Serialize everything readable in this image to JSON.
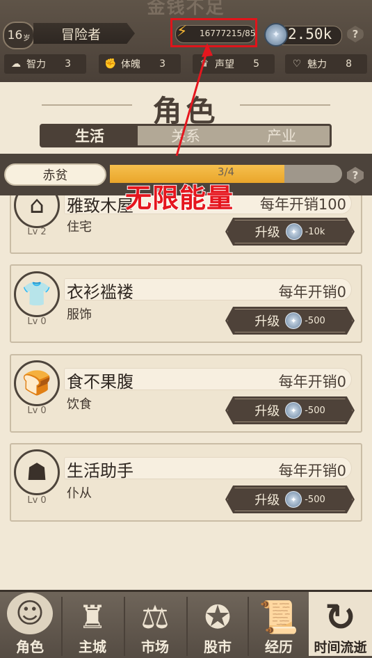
{
  "header": {
    "faded_title": "金钱不足",
    "age": "16",
    "age_unit": "岁",
    "title": "冒险者",
    "energy": "16777215/85",
    "coins": "2.50k",
    "help": "?"
  },
  "stats": [
    {
      "icon": "brain-icon",
      "label": "智力",
      "value": "3"
    },
    {
      "icon": "muscle-icon",
      "label": "体魄",
      "value": "3"
    },
    {
      "icon": "reputation-icon",
      "label": "声望",
      "value": "5"
    },
    {
      "icon": "heart-icon",
      "label": "魅力",
      "value": "8"
    }
  ],
  "section": {
    "title": "角色",
    "tabs": [
      "生活",
      "关系",
      "产业"
    ],
    "active_tab": 0
  },
  "status": {
    "level_name": "赤贫",
    "progress_text": "3/4",
    "progress_fraction": 0.75
  },
  "annotation": "无限能量",
  "items": [
    {
      "icon": "house-icon",
      "name": "雅致木屋",
      "cost": "每年开销100",
      "type": "住宅",
      "level": "Lv 2",
      "upgrade_label": "升级",
      "upgrade_cost": "-10k"
    },
    {
      "icon": "shirt-icon",
      "name": "衣衫褴褛",
      "cost": "每年开销0",
      "type": "服饰",
      "level": "Lv 0",
      "upgrade_label": "升级",
      "upgrade_cost": "-500"
    },
    {
      "icon": "food-basket-icon",
      "name": "食不果腹",
      "cost": "每年开销0",
      "type": "饮食",
      "level": "Lv 0",
      "upgrade_label": "升级",
      "upgrade_cost": "-500"
    },
    {
      "icon": "hooded-servant-icon",
      "name": "生活助手",
      "cost": "每年开销0",
      "type": "仆从",
      "level": "Lv 0",
      "upgrade_label": "升级",
      "upgrade_cost": "-500"
    }
  ],
  "nav": [
    {
      "icon": "character-icon",
      "label": "角色"
    },
    {
      "icon": "castle-icon",
      "label": "主城"
    },
    {
      "icon": "scales-icon",
      "label": "市场"
    },
    {
      "icon": "stock-icon",
      "label": "股市"
    },
    {
      "icon": "scroll-icon",
      "label": "经历"
    }
  ],
  "time_button": {
    "icon": "refresh-icon",
    "label": "时间流逝"
  },
  "colors": {
    "accent_red": "#e5161e",
    "energy_yellow": "#f4b534",
    "dark_brown": "#4b4037"
  }
}
